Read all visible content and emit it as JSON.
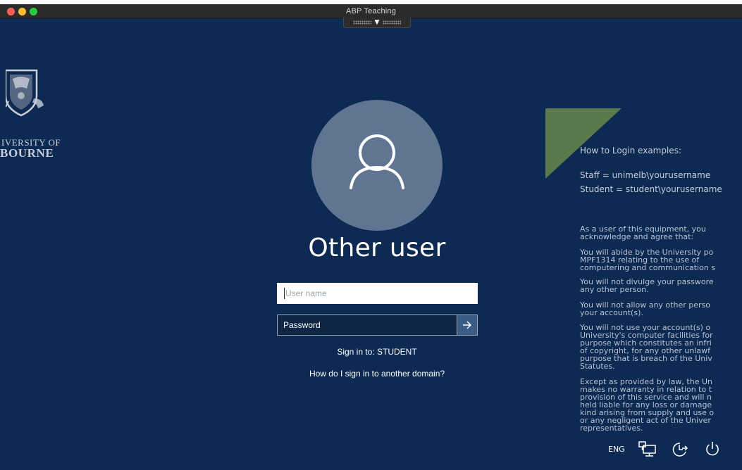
{
  "window": {
    "title": "ABP Teaching"
  },
  "university": {
    "line1": "IVERSITY OF",
    "line2": "BOURNE"
  },
  "login": {
    "user_title": "Other user",
    "username_placeholder": "User name",
    "password_placeholder": "Password",
    "sign_in_to": "Sign in to: STUDENT",
    "other_domain_link": "How do I sign in to another domain?"
  },
  "notice": {
    "heading": "How to Login examples:",
    "staff_example": "Staff = unimelb\\yourusername",
    "student_example": "Student = student\\yourusername",
    "paragraphs": [
      [
        "As a user of this equipment, you",
        "acknowledge and agree that:"
      ],
      [
        "You will abide by the University po",
        "MPF1314 relating to the use of",
        "computering and communication s"
      ],
      [
        "You will not divulge your passwore",
        "any other person."
      ],
      [
        "You will not allow any other perso",
        "your account(s)."
      ],
      [
        "You will not use your account(s) o",
        "University's computer facilities for",
        "purpose which constitutes an infri",
        "of copyright, for any other unlawf",
        "purpose that is breach of the Univ",
        "Statutes."
      ],
      [
        "Except as provided by law, the Un",
        "makes no warranty in relation to t",
        "provision of this service and will n",
        "held liable for any loss or damage",
        "kind arising from supply and use o",
        "or any negligent act of the Univer",
        "representatives."
      ]
    ]
  },
  "system_bar": {
    "language": "ENG",
    "icons": [
      "network-icon",
      "accessibility-icon",
      "power-icon"
    ]
  },
  "colors": {
    "background": "#0d2a52",
    "avatar_circle": "#5f7591",
    "wedge_green": "#5b7a4b",
    "submit_button": "#3b5d85"
  }
}
